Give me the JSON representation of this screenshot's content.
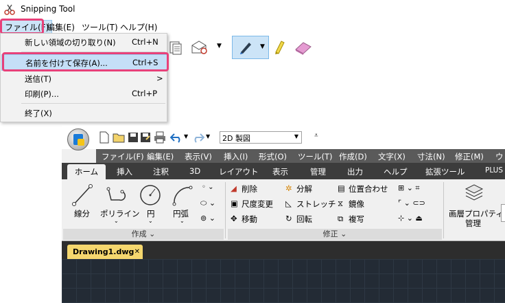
{
  "snipping_tool": {
    "title": "Snipping Tool",
    "menu": [
      "ファイル(F)",
      "編集(E)",
      "ツール(T)",
      "ヘルプ(H)"
    ],
    "file_menu_items": [
      {
        "label": "新しい領域の切り取り(N)",
        "shortcut": "Ctrl+N"
      },
      {
        "label": "名前を付けて保存(A)...",
        "shortcut": "Ctrl+S"
      },
      {
        "label": "送信(T)",
        "shortcut": ">"
      },
      {
        "label": "印刷(P)...",
        "shortcut": "Ctrl+P"
      },
      {
        "label": "終了(X)",
        "shortcut": ""
      }
    ],
    "highlight_color": "#e8417a"
  },
  "cad": {
    "workspace": "2D 製図",
    "menu": [
      "ファイル(F)",
      "編集(E)",
      "表示(V)",
      "挿入(I)",
      "形式(O)",
      "ツール(T)",
      "作成(D)",
      "文字(X)",
      "寸法(N)",
      "修正(M)",
      "ウ"
    ],
    "tabs": [
      "ホーム",
      "挿入",
      "注釈",
      "3D",
      "レイアウト",
      "表示",
      "管理",
      "出力",
      "ヘルプ",
      "拡張ツール",
      "PLUS"
    ],
    "draw_panel": {
      "title": "作成 ⌄",
      "tools": [
        "線分",
        "ポリライン",
        "円",
        "円弧"
      ]
    },
    "modify_panel": {
      "title": "修正 ⌄",
      "tools": [
        "削除",
        "分解",
        "位置合わせ",
        "尺度変更",
        "ストレッチ",
        "鏡像",
        "移動",
        "回転",
        "複写"
      ]
    },
    "properties_panel": {
      "tools": [
        "画層プロパティ",
        "管理"
      ]
    },
    "document_tab": "Drawing1.dwg",
    "close_glyph": "✕"
  }
}
